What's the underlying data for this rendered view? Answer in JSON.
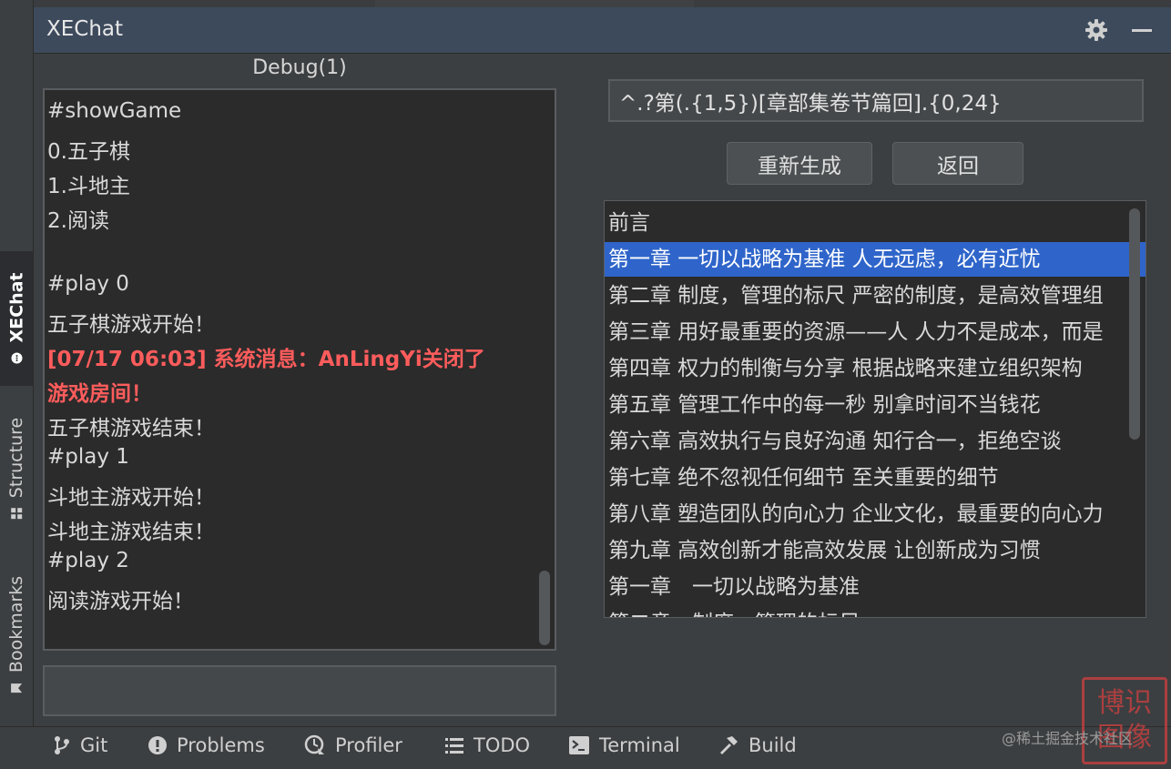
{
  "left_strip": {
    "tabs": [
      {
        "label": "XEChat",
        "icon": "chat-bubble-icon",
        "active": true
      },
      {
        "label": "Structure",
        "icon": "structure-icon",
        "active": false
      },
      {
        "label": "Bookmarks",
        "icon": "bookmark-icon",
        "active": false
      }
    ]
  },
  "panel": {
    "title": "XEChat",
    "icons": {
      "settings": "gear-icon",
      "minimize": "minimize-icon"
    }
  },
  "chat": {
    "title": "Debug(1)",
    "lines": [
      {
        "text": "#showGame",
        "type": "normal"
      },
      {
        "text": "0.五子棋",
        "type": "normal"
      },
      {
        "text": "1.斗地主",
        "type": "normal"
      },
      {
        "text": "2.阅读",
        "type": "normal"
      },
      {
        "text": "#play 0",
        "type": "normal"
      },
      {
        "text": "五子棋游戏开始！",
        "type": "normal"
      },
      {
        "text": "[07/17 06:03] 系统消息：AnLingYi关闭了",
        "type": "system"
      },
      {
        "text": "游戏房间！",
        "type": "system"
      },
      {
        "text": "五子棋游戏结束！",
        "type": "normal"
      },
      {
        "text": "#play 1",
        "type": "normal"
      },
      {
        "text": "斗地主游戏开始！",
        "type": "normal"
      },
      {
        "text": "斗地主游戏结束！",
        "type": "normal"
      },
      {
        "text": "#play 2",
        "type": "normal"
      },
      {
        "text": "阅读游戏开始！",
        "type": "normal"
      }
    ],
    "input_value": ""
  },
  "reader": {
    "regex_value": "^.?第(.{1,5})[章部集卷节篇回].{0,24}",
    "regenerate_label": "重新生成",
    "back_label": "返回",
    "chapters": [
      {
        "text": "前言",
        "selected": false
      },
      {
        "text": "第一章 一切以战略为基准 人无远虑，必有近忧",
        "selected": true
      },
      {
        "text": "第二章 制度，管理的标尺 严密的制度，是高效管理组",
        "selected": false
      },
      {
        "text": "第三章 用好最重要的资源——人 人力不是成本，而是",
        "selected": false
      },
      {
        "text": "第四章 权力的制衡与分享 根据战略来建立组织架构",
        "selected": false
      },
      {
        "text": "第五章 管理工作中的每一秒 别拿时间不当钱花",
        "selected": false
      },
      {
        "text": "第六章 高效执行与良好沟通 知行合一，拒绝空谈",
        "selected": false
      },
      {
        "text": "第七章 绝不忽视任何细节 至关重要的细节",
        "selected": false
      },
      {
        "text": "第八章 塑造团队的向心力 企业文化，最重要的向心力",
        "selected": false
      },
      {
        "text": "第九章 高效创新才能高效发展 让创新成为习惯",
        "selected": false
      },
      {
        "text": "第一章　一切以战略为基准",
        "selected": false
      },
      {
        "text": "第二章　制度，管理的标尺",
        "selected": false
      }
    ]
  },
  "bottom_bar": {
    "items": [
      {
        "label": "Git",
        "icon": "git-branch-icon"
      },
      {
        "label": "Problems",
        "icon": "problems-icon"
      },
      {
        "label": "Profiler",
        "icon": "profiler-icon"
      },
      {
        "label": "TODO",
        "icon": "todo-list-icon"
      },
      {
        "label": "Terminal",
        "icon": "terminal-icon"
      },
      {
        "label": "Build",
        "icon": "hammer-icon"
      }
    ]
  },
  "watermark": {
    "text": "@稀土掘金技术社区",
    "seal_text": "博识\n图像"
  },
  "colors": {
    "selection": "#2f65ca",
    "system_message": "#ff5c5c",
    "header": "#3d4a5c"
  }
}
